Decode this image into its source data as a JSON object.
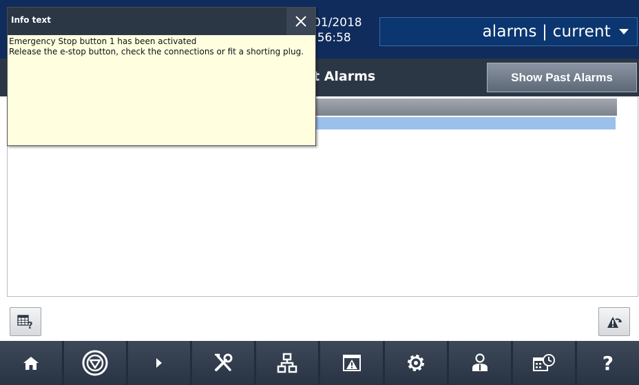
{
  "header": {
    "date": "01/2018",
    "time": ":56:58",
    "screen_selector": "alarms | current"
  },
  "toolbar": {
    "title": "t Alarms",
    "show_past_alarms": "Show Past Alarms"
  },
  "popup": {
    "title": "Info text",
    "line1": "Emergency Stop button 1 has been activated",
    "line2": "Release the e-stop button, check the connections or fit a shorting plug."
  },
  "nav": {
    "items": [
      "home-icon",
      "emergency-stop-icon",
      "play-icon",
      "tools-icon",
      "network-icon",
      "alarm-icon",
      "gear-icon",
      "user-icon",
      "schedule-icon",
      "help-icon"
    ],
    "help_label": "?"
  },
  "colors": {
    "header_bg": "#0f2c5c",
    "toolbar_bg": "#2c3746",
    "popup_bg": "#ffffe0",
    "selection": "#9cc0ec"
  }
}
